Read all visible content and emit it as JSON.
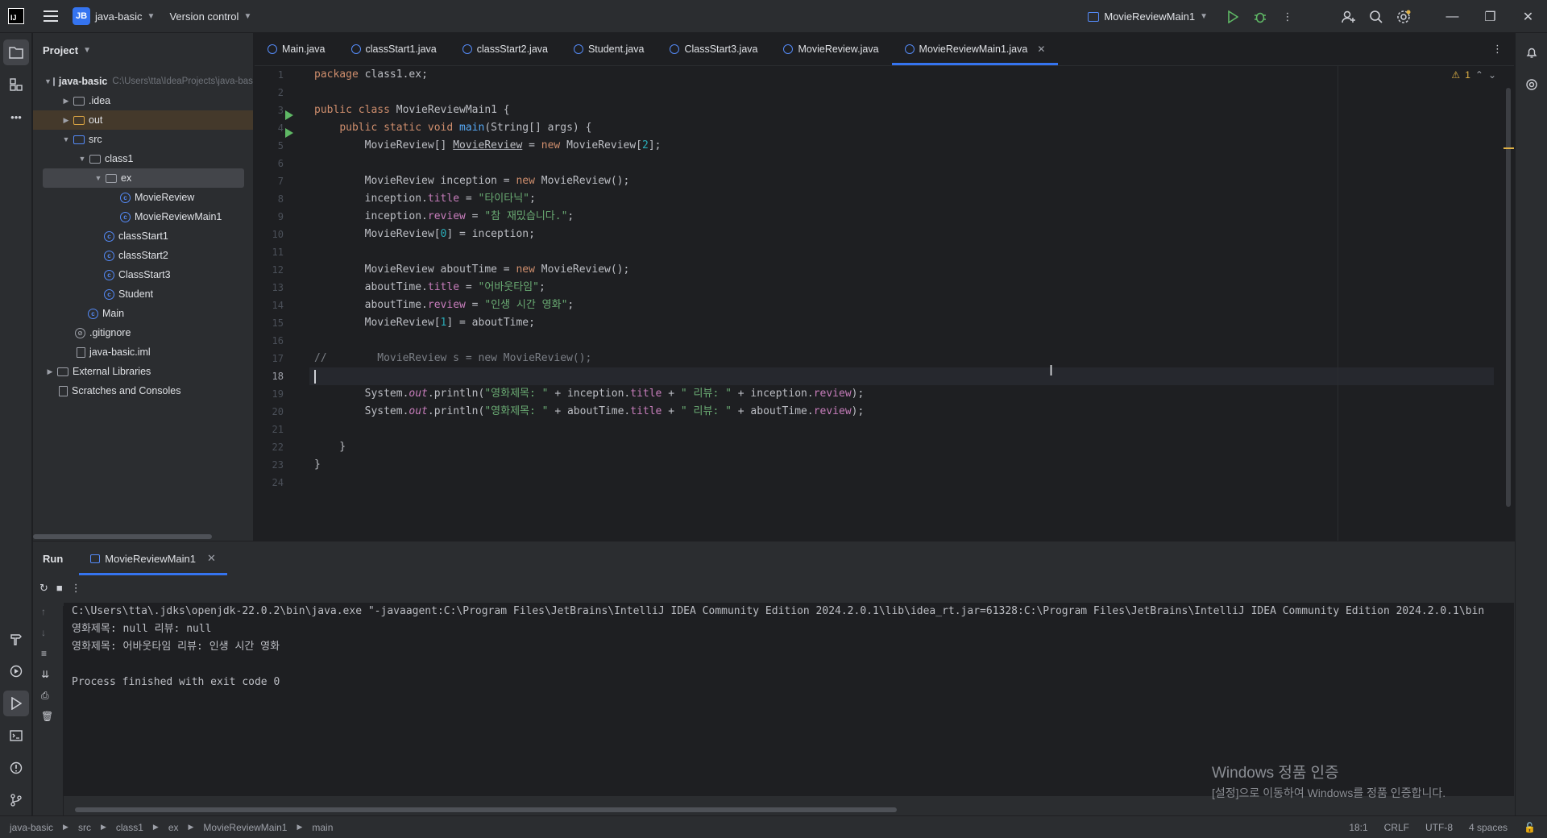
{
  "titlebar": {
    "logo": "IJ",
    "project_badge": "JB",
    "project_name": "java-basic",
    "vcs": "Version control",
    "run_config": "MovieReviewMain1"
  },
  "project_panel": {
    "title": "Project",
    "root_name": "java-basic",
    "root_path": "C:\\Users\\tta\\IdeaProjects\\java-basic",
    "items": [
      {
        "label": ".idea"
      },
      {
        "label": "out"
      },
      {
        "label": "src"
      },
      {
        "label": "class1"
      },
      {
        "label": "ex"
      },
      {
        "label": "MovieReview"
      },
      {
        "label": "MovieReviewMain1"
      },
      {
        "label": "classStart1"
      },
      {
        "label": "classStart2"
      },
      {
        "label": "ClassStart3"
      },
      {
        "label": "Student"
      },
      {
        "label": "Main"
      },
      {
        "label": ".gitignore"
      },
      {
        "label": "java-basic.iml"
      },
      {
        "label": "External Libraries"
      },
      {
        "label": "Scratches and Consoles"
      }
    ]
  },
  "tabs": [
    {
      "label": "Main.java"
    },
    {
      "label": "classStart1.java"
    },
    {
      "label": "classStart2.java"
    },
    {
      "label": "Student.java"
    },
    {
      "label": "ClassStart3.java"
    },
    {
      "label": "MovieReview.java"
    },
    {
      "label": "MovieReviewMain1.java"
    }
  ],
  "editor": {
    "warning_count": "1",
    "line_numbers": [
      "1",
      "2",
      "3",
      "4",
      "5",
      "6",
      "7",
      "8",
      "9",
      "10",
      "11",
      "12",
      "13",
      "14",
      "15",
      "16",
      "17",
      "18",
      "19",
      "20",
      "21",
      "22",
      "23",
      "24"
    ]
  },
  "run_panel": {
    "title": "Run",
    "tab": "MovieReviewMain1",
    "output": [
      "C:\\Users\\tta\\.jdks\\openjdk-22.0.2\\bin\\java.exe \"-javaagent:C:\\Program Files\\JetBrains\\IntelliJ IDEA Community Edition 2024.2.0.1\\lib\\idea_rt.jar=61328:C:\\Program Files\\JetBrains\\IntelliJ IDEA Community Edition 2024.2.0.1\\bin",
      "영화제목: null 리뷰: null",
      "영화제목: 어바웃타임 리뷰: 인생 시간 영화",
      "",
      "Process finished with exit code 0"
    ]
  },
  "statusbar": {
    "breadcrumbs": [
      "java-basic",
      "src",
      "class1",
      "ex",
      "MovieReviewMain1",
      "main"
    ],
    "position": "18:1",
    "line_sep": "CRLF",
    "encoding": "UTF-8",
    "indent": "4 spaces"
  },
  "activation": {
    "title": "Windows 정품 인증",
    "subtitle": "[설정]으로 이동하여 Windows를 정품 인증합니다."
  }
}
